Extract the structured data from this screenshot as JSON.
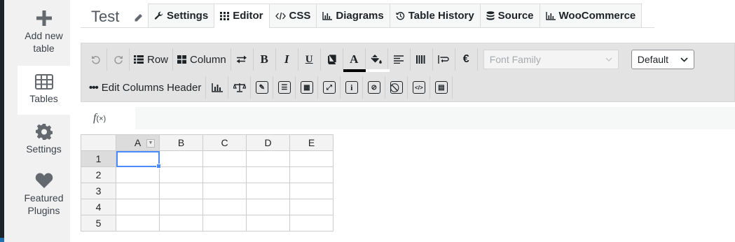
{
  "sidebar": {
    "items": [
      {
        "label": "Add new table",
        "icon": "plus-icon"
      },
      {
        "label": "Tables",
        "icon": "table-icon"
      },
      {
        "label": "Settings",
        "icon": "gear-icon"
      },
      {
        "label": "Featured Plugins",
        "icon": "heart-icon"
      }
    ]
  },
  "header": {
    "title": "Test",
    "tabs": [
      {
        "label": "Settings",
        "icon": "wrench-icon"
      },
      {
        "label": "Editor",
        "icon": "grid-icon"
      },
      {
        "label": "CSS",
        "icon": "code-icon"
      },
      {
        "label": "Diagrams",
        "icon": "bar-chart-icon"
      },
      {
        "label": "Table History",
        "icon": "history-icon"
      },
      {
        "label": "Source",
        "icon": "database-icon"
      },
      {
        "label": "WooCommerce",
        "icon": "bar-chart-icon"
      }
    ]
  },
  "toolbar": {
    "row_label": "Row",
    "column_label": "Column",
    "bold": "B",
    "italic": "I",
    "underline": "U",
    "text_color": "A",
    "currency": "€",
    "font_family_placeholder": "Font Family",
    "font_size_value": "Default",
    "edit_columns_header": "Edit Columns Header",
    "text_color_bar": "#000000",
    "fill_color_bar": "#ffffff"
  },
  "formula": {
    "fx_label": "f",
    "fx_sub": "(×)",
    "value": ""
  },
  "grid": {
    "columns": [
      "A",
      "B",
      "C",
      "D",
      "E"
    ],
    "rows": [
      "1",
      "2",
      "3",
      "4",
      "5"
    ],
    "selected_cell": "A1"
  }
}
